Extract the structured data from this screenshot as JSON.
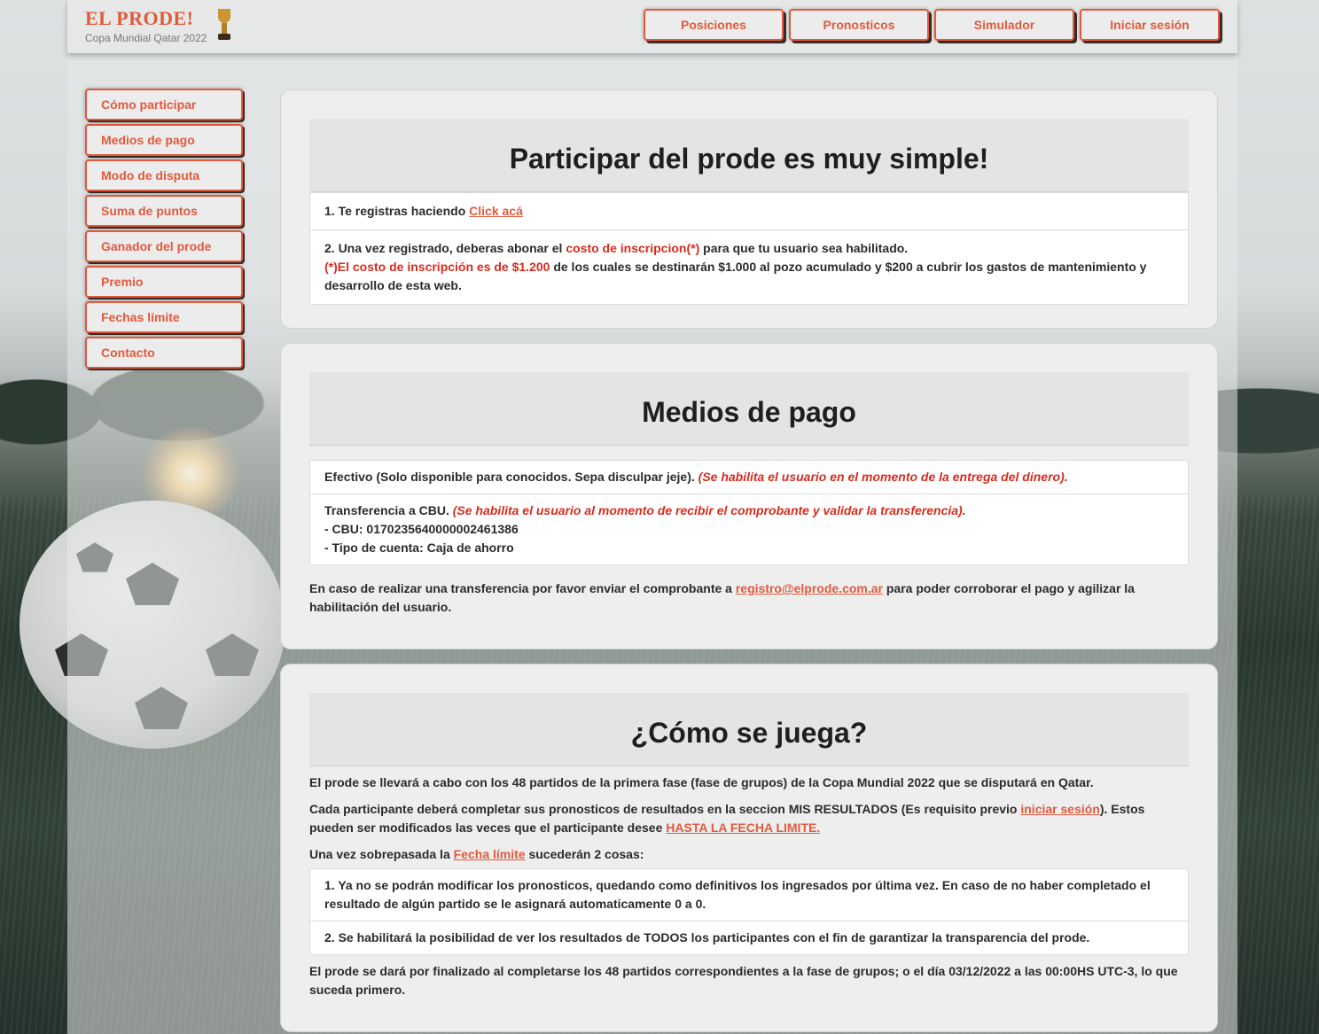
{
  "header": {
    "logo_title": "EL PRODE!",
    "logo_subtitle": "Copa Mundial Qatar 2022",
    "trophy_icon": "trophy-icon",
    "nav": [
      "Posiciones",
      "Pronosticos",
      "Simulador",
      "Iniciar sesión"
    ]
  },
  "sidebar": {
    "items": [
      "Cómo participar",
      "Medios de pago",
      "Modo de disputa",
      "Suma de puntos",
      "Ganador del prode",
      "Premio",
      "Fechas límite",
      "Contacto"
    ]
  },
  "colors": {
    "accent": "#e05a3d",
    "highlight_red": "#d42d1f",
    "text": "#2b2b2b"
  },
  "participar": {
    "title": "Participar del prode es muy simple!",
    "step1_text": "1. Te registras haciendo ",
    "step1_link": "Click acá",
    "step2_text_a": "2. Una vez registrado, deberas abonar el ",
    "step2_highlight": "costo de inscripcion(*)",
    "step2_text_b": " para que tu usuario sea habilitado.",
    "step2_note_red": "(*)El costo de inscripción es de $1.200",
    "step2_note_rest": " de los cuales se destinarán $1.000 al pozo acumulado y $200 a cubrir los gastos de mantenimiento y desarrollo de esta web."
  },
  "medios": {
    "title": "Medios de pago",
    "efectivo_text": "Efectivo (Solo disponible para conocidos. Sepa disculpar jeje). ",
    "efectivo_note": "(Se habilita el usuario en el momento de la entrega del dinero).",
    "transfer_text": "Transferencia a CBU. ",
    "transfer_note": "(Se habilita el usuario al momento de recibir el comprobante y validar la transferencia).",
    "cbu_line": "- CBU: 0170235640000002461386",
    "tipo_line": "- Tipo de cuenta: Caja de ahorro",
    "footer_a": "En caso de realizar una transferencia por favor enviar el comprobante a ",
    "footer_email": "registro@elprode.com.ar",
    "footer_b": " para poder corroborar el pago y agilizar la habilitación del usuario."
  },
  "juega": {
    "title": "¿Cómo se juega?",
    "p1": "El prode se llevará a cabo con los 48 partidos de la primera fase (fase de grupos) de la Copa Mundial 2022 que se disputará en Qatar.",
    "p2_a": "Cada participante deberá completar sus pronosticos de resultados en la seccion MIS RESULTADOS (Es requisito previo ",
    "p2_link": "iniciar sesión",
    "p2_b": "). Estos pueden ser modificados las veces que el participante desee ",
    "p2_link2": "HASTA LA FECHA LIMITE.",
    "p3_a": "Una vez sobrepasada la ",
    "p3_link": "Fecha límite",
    "p3_b": " sucederán 2 cosas:",
    "item1": "1. Ya no se podrán modificar los pronosticos, quedando como definitivos los ingresados por última vez. En caso de no haber completado el resultado de algún partido se le asignará automaticamente 0 a 0.",
    "item2": "2. Se habilitará la posibilidad de ver los resultados de TODOS los participantes con el fin de garantizar la transparencia del prode.",
    "p4": "El prode se dará por finalizado al completarse los 48 partidos correspondientes a la fase de grupos; o el día 03/12/2022 a las 00:00HS UTC-3, lo que suceda primero."
  }
}
